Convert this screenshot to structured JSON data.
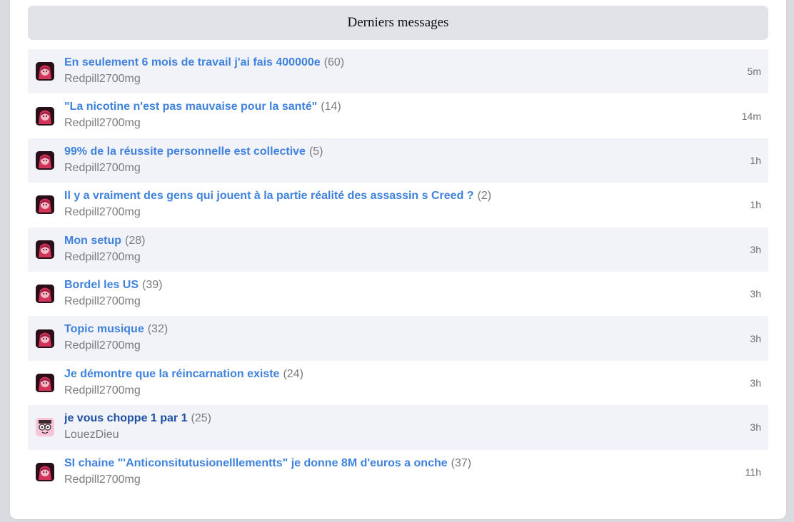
{
  "header": {
    "title": "Derniers messages"
  },
  "topics": [
    {
      "title": "En seulement 6 mois de travail j'ai fais 400000e",
      "count": "(60)",
      "author": "Redpill2700mg",
      "time": "5m",
      "avatar": "redpill-avatar-icon"
    },
    {
      "title": "\"La nicotine n'est pas mauvaise pour la santé\"",
      "count": "(14)",
      "author": "Redpill2700mg",
      "time": "14m",
      "avatar": "redpill-avatar-icon"
    },
    {
      "title": "99% de la réussite personnelle est collective",
      "count": "(5)",
      "author": "Redpill2700mg",
      "time": "1h",
      "avatar": "redpill-avatar-icon"
    },
    {
      "title": "Il y a vraiment des gens qui jouent à la partie réalité des assassin s Creed ?",
      "count": "(2)",
      "author": "Redpill2700mg",
      "time": "1h",
      "avatar": "redpill-avatar-icon"
    },
    {
      "title": "Mon setup",
      "count": "(28)",
      "author": "Redpill2700mg",
      "time": "3h",
      "avatar": "redpill-avatar-icon"
    },
    {
      "title": "Bordel les US",
      "count": "(39)",
      "author": "Redpill2700mg",
      "time": "3h",
      "avatar": "redpill-avatar-icon"
    },
    {
      "title": "Topic musique",
      "count": "(32)",
      "author": "Redpill2700mg",
      "time": "3h",
      "avatar": "redpill-avatar-icon"
    },
    {
      "title": "Je démontre que la réincarnation existe",
      "count": "(24)",
      "author": "Redpill2700mg",
      "time": "3h",
      "avatar": "redpill-avatar-icon"
    },
    {
      "title": "je vous choppe 1 par 1",
      "count": "(25)",
      "author": "LouezDieu",
      "time": "3h",
      "avatar": "pink-face-avatar-icon"
    },
    {
      "title": "SI chaine \"'Anticonsitutusionelllementts\" je donne 8M d'euros a onche",
      "count": "(37)",
      "author": "Redpill2700mg",
      "time": "11h",
      "avatar": "redpill-avatar-icon"
    }
  ],
  "colors": {
    "link": "#3f82dd",
    "link_visited": "#1f4fa3",
    "row_alt": "#f1f3f8",
    "header_bg": "#e2e3e8",
    "muted": "#7b7b7b"
  }
}
